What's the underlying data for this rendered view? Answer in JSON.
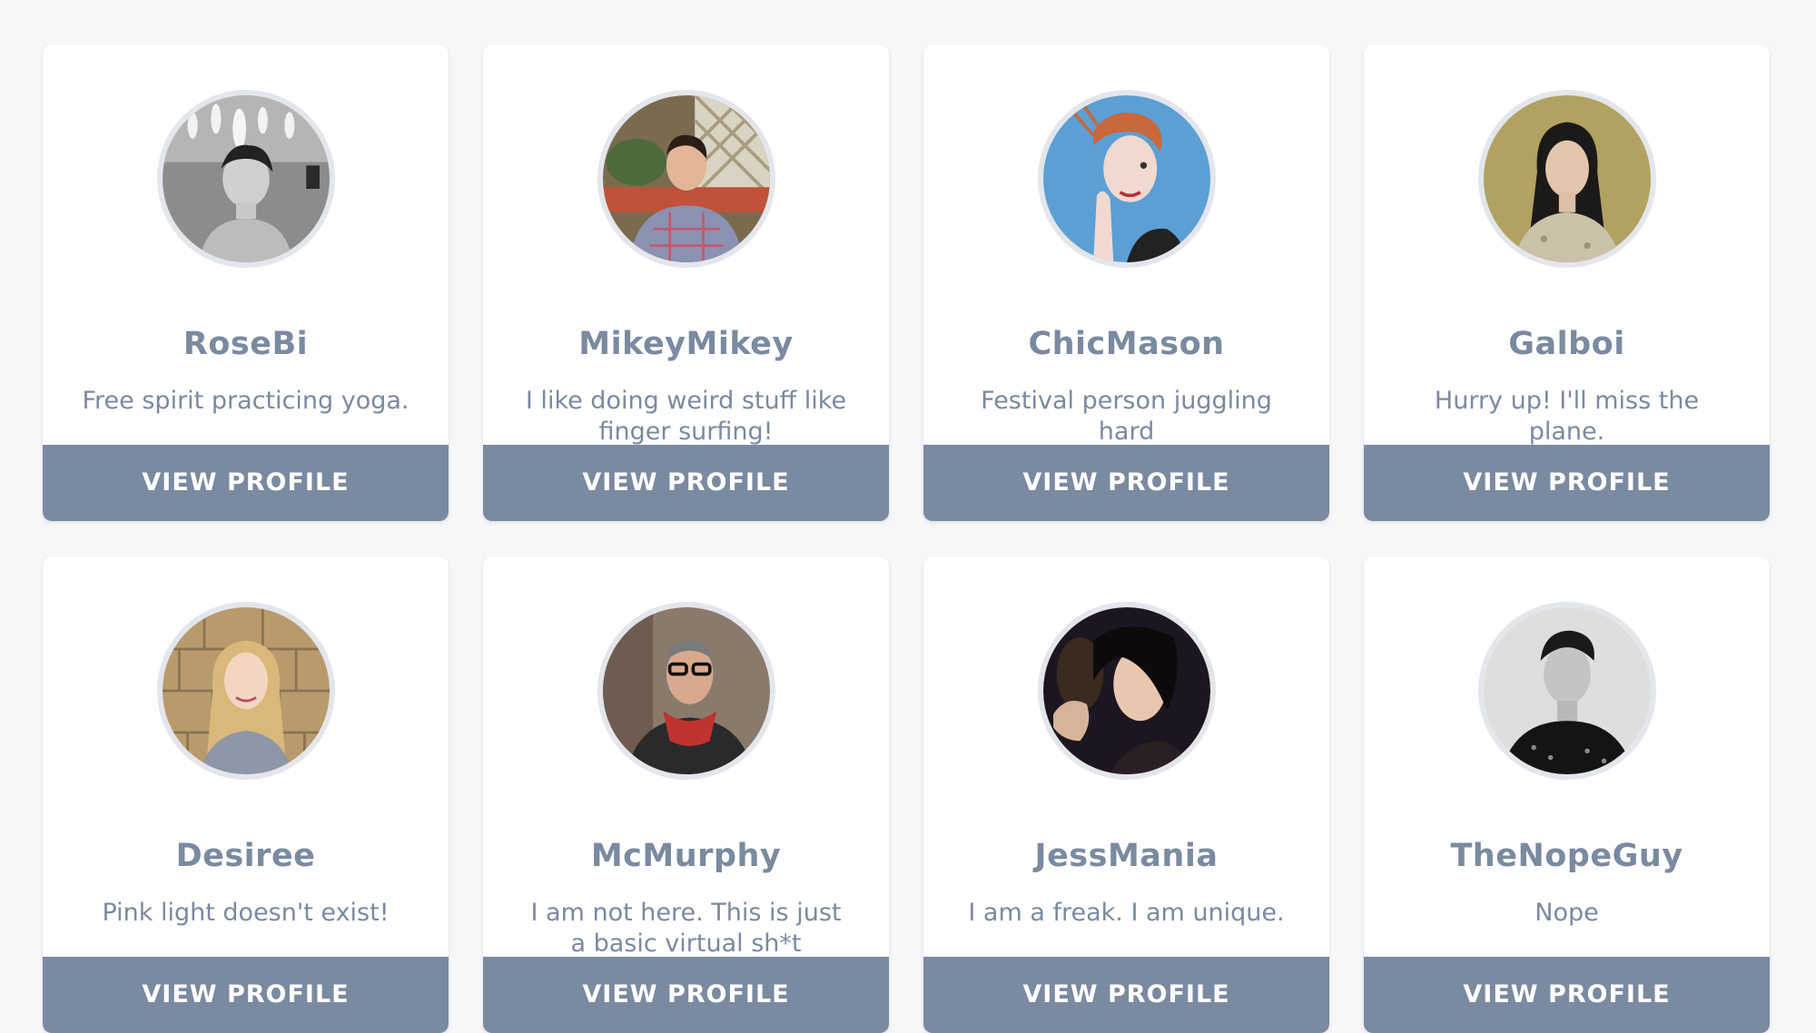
{
  "colors": {
    "page_background": "#f6f7f9",
    "card_background": "#ffffff",
    "accent": "#7a8aa0",
    "avatar_ring": "#e3e6eb",
    "button_text": "#ffffff"
  },
  "profiles": [
    {
      "name": "RoseBi",
      "bio": "Free spirit practicing yoga.",
      "button_label": "VIEW PROFILE"
    },
    {
      "name": "MikeyMikey",
      "bio": "I like doing weird stuff like finger surfing!",
      "button_label": "VIEW PROFILE"
    },
    {
      "name": "ChicMason",
      "bio": "Festival person juggling hard",
      "button_label": "VIEW PROFILE"
    },
    {
      "name": "Galboi",
      "bio": "Hurry up! I'll miss the plane.",
      "button_label": "VIEW PROFILE"
    },
    {
      "name": "Desiree",
      "bio": "Pink light doesn't exist!",
      "button_label": "VIEW PROFILE"
    },
    {
      "name": "McMurphy",
      "bio": "I am not here. This is just a basic virtual sh*t",
      "button_label": "VIEW PROFILE"
    },
    {
      "name": "JessMania",
      "bio": "I am a freak. I am unique.",
      "button_label": "VIEW PROFILE"
    },
    {
      "name": "TheNopeGuy",
      "bio": "Nope",
      "button_label": "VIEW PROFILE"
    }
  ]
}
